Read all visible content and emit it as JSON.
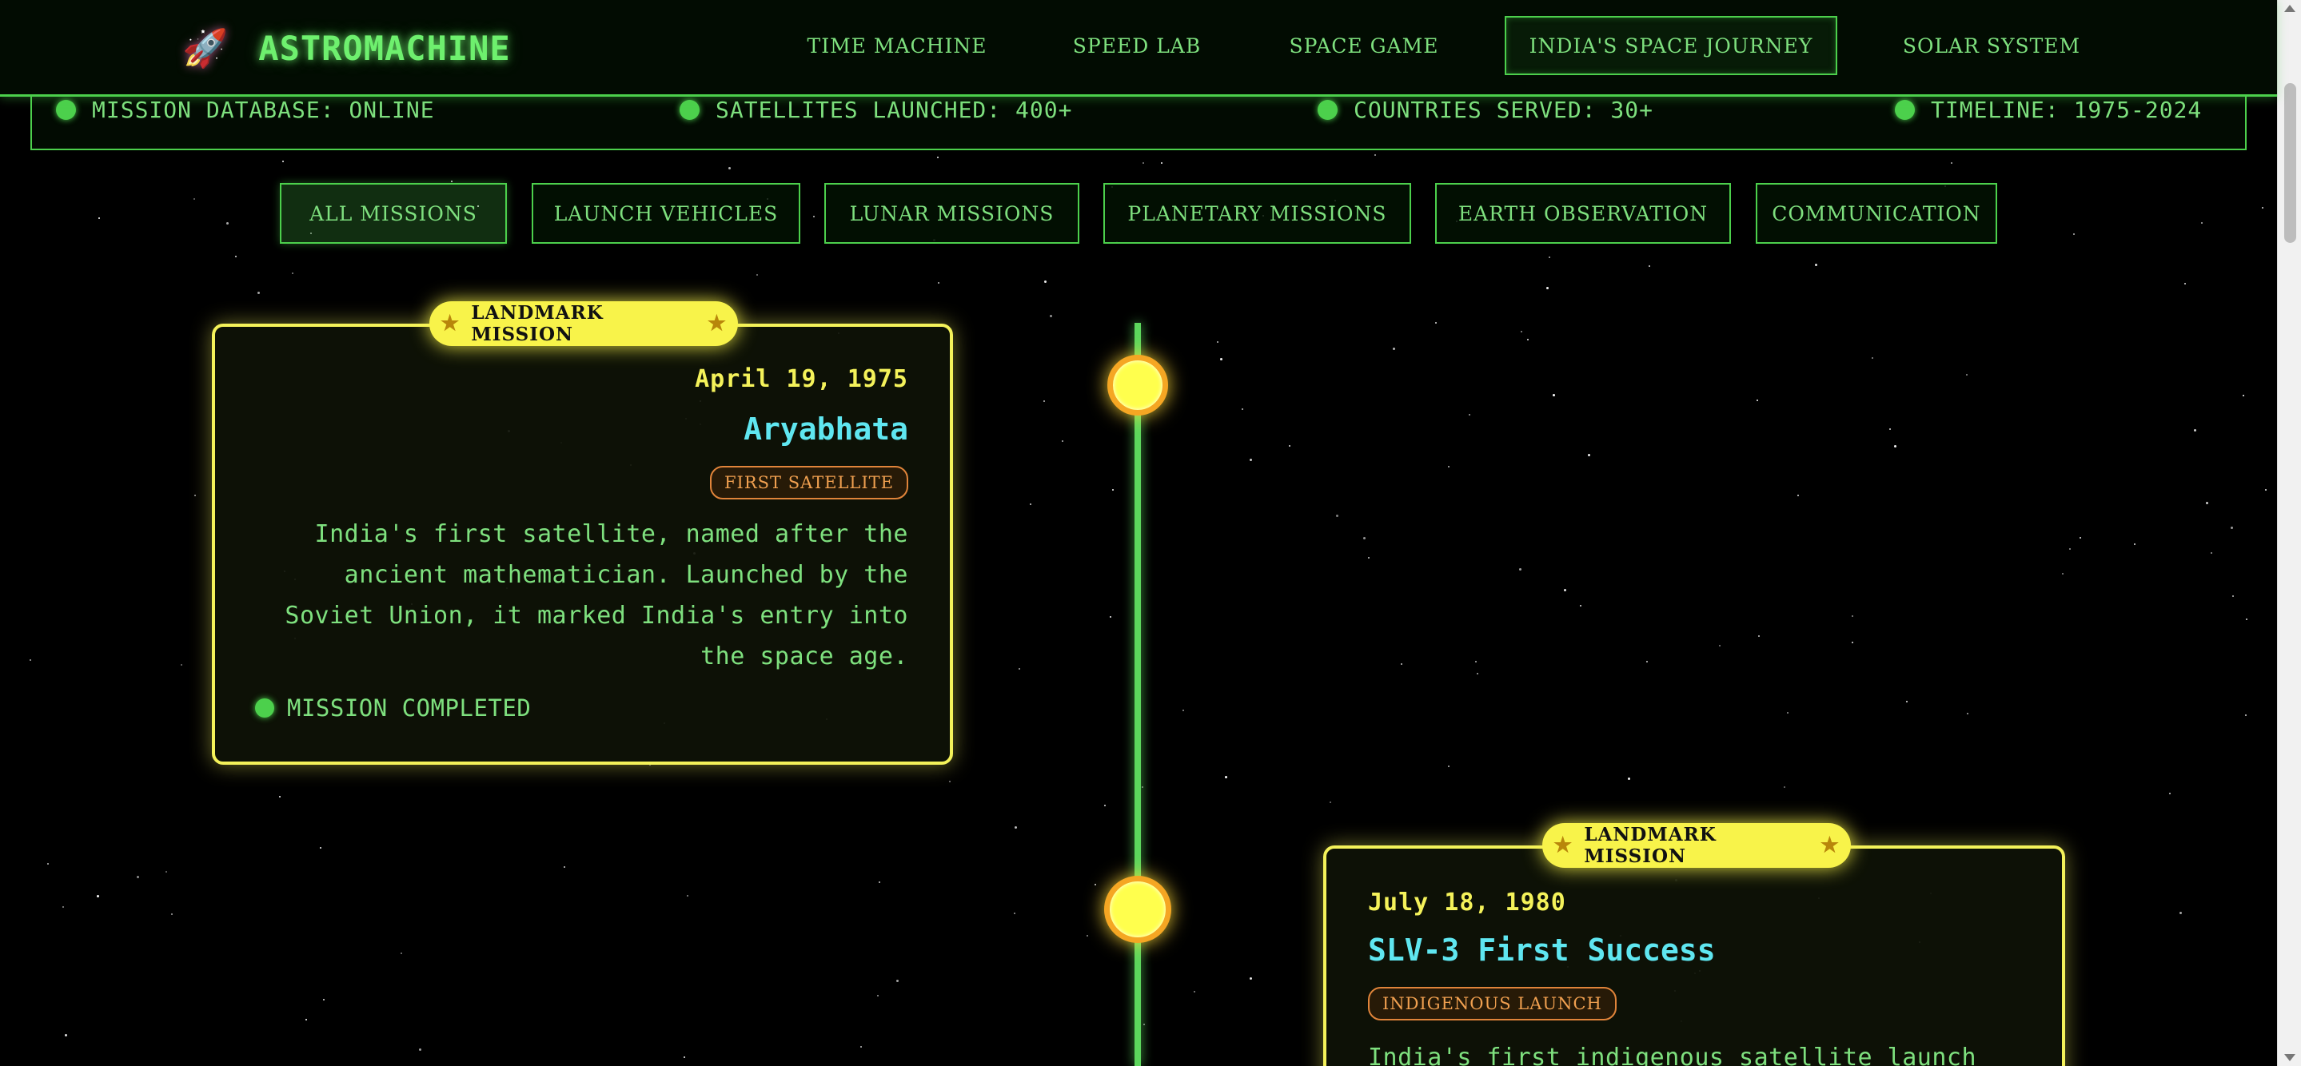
{
  "header": {
    "logo_icon": "rocket-icon",
    "logo_emoji": "🚀",
    "logo_text": "ASTROMACHINE",
    "nav": [
      {
        "label": "TIME MACHINE",
        "active": false
      },
      {
        "label": "SPEED LAB",
        "active": false
      },
      {
        "label": "SPACE GAME",
        "active": false
      },
      {
        "label": "INDIA'S SPACE JOURNEY",
        "active": true
      },
      {
        "label": "SOLAR SYSTEM",
        "active": false
      }
    ]
  },
  "status_bar": [
    {
      "label": "MISSION DATABASE: ONLINE"
    },
    {
      "label": "SATELLITES LAUNCHED: 400+"
    },
    {
      "label": "COUNTRIES SERVED: 30+"
    },
    {
      "label": "TIMELINE: 1975-2024"
    }
  ],
  "filters": [
    {
      "label": "ALL MISSIONS",
      "active": true
    },
    {
      "label": "LAUNCH VEHICLES",
      "active": false
    },
    {
      "label": "LUNAR MISSIONS",
      "active": false
    },
    {
      "label": "PLANETARY MISSIONS",
      "active": false
    },
    {
      "label": "EARTH OBSERVATION",
      "active": false
    },
    {
      "label": "COMMUNICATION",
      "active": false
    }
  ],
  "missions": [
    {
      "badge": "LANDMARK MISSION",
      "date": "April 19, 1975",
      "title": "Aryabhata",
      "tag": "FIRST SATELLITE",
      "description_lines": [
        "India's first satellite, named after the",
        "ancient mathematician. Launched by the",
        "Soviet Union, it marked India's entry into",
        "the space age."
      ],
      "status": "MISSION COMPLETED"
    },
    {
      "badge": "LANDMARK MISSION",
      "date": "July 18, 1980",
      "title": "SLV-3 First Success",
      "tag": "INDIGENOUS LAUNCH",
      "description_lines": [
        "India's first indigenous satellite launch"
      ]
    }
  ],
  "colors": {
    "accent_green": "#4cd04c",
    "landmark_yellow": "#f4f25a",
    "title_cyan": "#5fe6f0",
    "tag_orange": "#e0843a"
  }
}
